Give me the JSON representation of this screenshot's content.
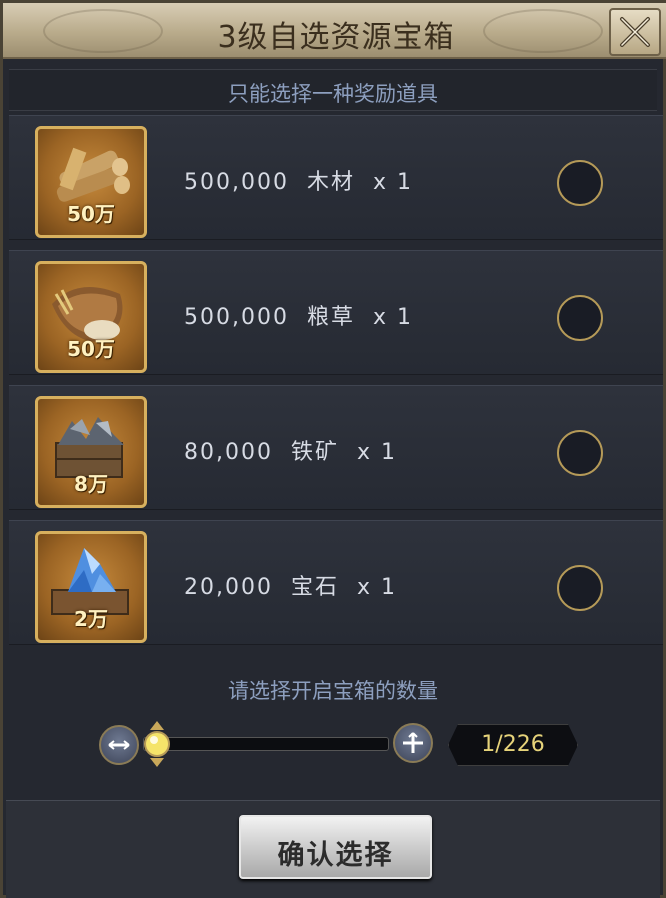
{
  "window": {
    "title": "3级自选资源宝箱",
    "close_icon": "close-icon"
  },
  "subtitle": "只能选择一种奖励道具",
  "items": [
    {
      "icon": "wood-icon",
      "badge": "50万",
      "label": "500,000  木材  x 1",
      "selected": false
    },
    {
      "icon": "grain-icon",
      "badge": "50万",
      "label": "500,000  粮草  x 1",
      "selected": false
    },
    {
      "icon": "iron-ore-icon",
      "badge": "8万",
      "label": "80,000  铁矿  x 1",
      "selected": false
    },
    {
      "icon": "gem-icon",
      "badge": "2万",
      "label": "20,000  宝石  x 1",
      "selected": false
    }
  ],
  "quantity": {
    "label": "请选择开启宝箱的数量",
    "display": "1/226",
    "current": 1,
    "max": 226
  },
  "confirm_label": "确认选择",
  "colors": {
    "accent_gold": "#b59a58",
    "text_blue": "#8d9fbf",
    "count_yellow": "#e6d37a"
  }
}
